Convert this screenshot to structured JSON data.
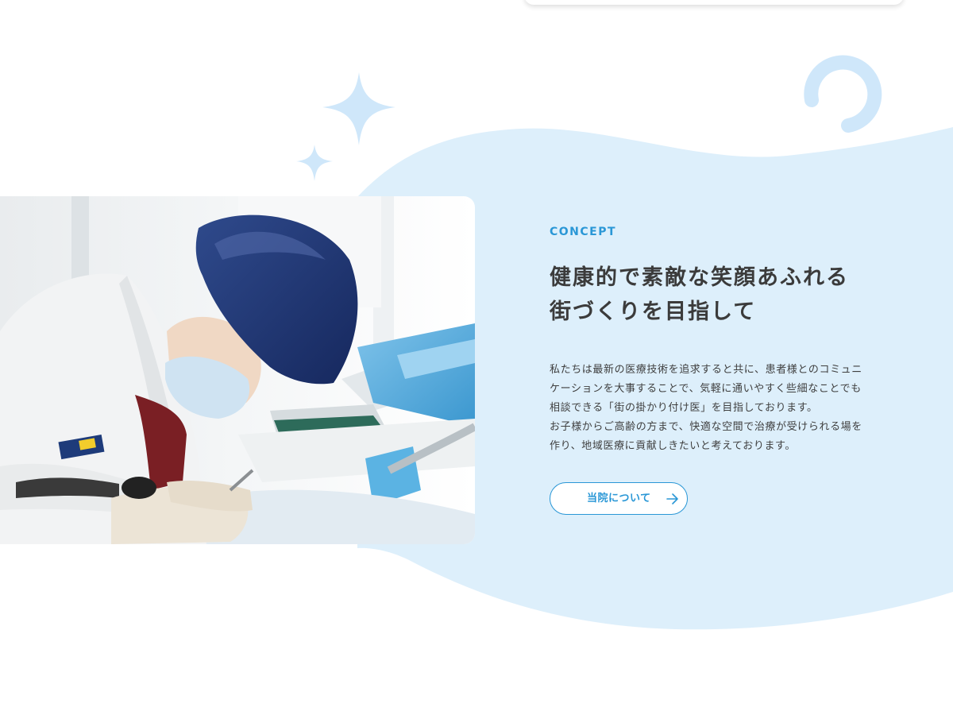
{
  "theme": {
    "accent": "#2a97d6",
    "blob": "#ddeffb",
    "heading": "#3b3b3b",
    "text": "#3f3f3f"
  },
  "concept": {
    "eyebrow": "CONCEPT",
    "headline_lines": [
      "健康的で素敵な笑顔あふれる",
      "街づくりを目指して"
    ],
    "body_lines": [
      "私たちは最新の医療技術を追求すると共に、患者様とのコミュニ",
      "ケーションを大事することで、気軽に通いやすく些細なことでも",
      "相談できる「街の掛かり付け医」を目指しております。",
      "お子様からご高齢の方まで、快適な空間で治療が受けられる場を",
      "作り、地域医療に貢献しきたいと考えております。"
    ],
    "button_label": "当院について",
    "button_icon": "arrow-right-icon"
  },
  "decor": {
    "icons": [
      "sparkle-icon",
      "sparkle-icon",
      "ring-icon"
    ]
  },
  "photo": {
    "subject": "dentist-at-work-photo"
  }
}
